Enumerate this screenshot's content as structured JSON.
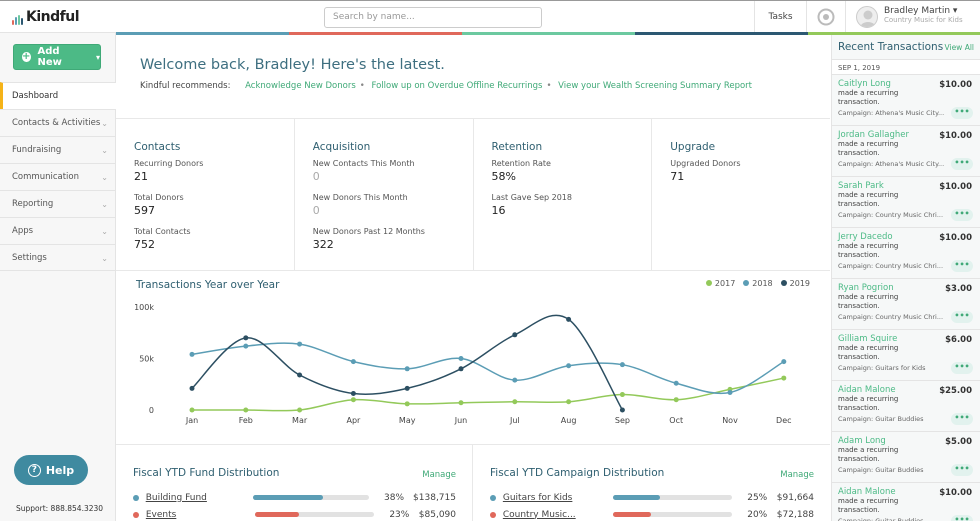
{
  "header": {
    "logo": "Kindful",
    "search_placeholder": "Search by name...",
    "tasks": "Tasks",
    "user_name": "Bradley Martin",
    "user_org": "Country Music for Kids"
  },
  "colors": {
    "accent": "#4cba86",
    "bar": [
      "#5b9db5",
      "#e0685b",
      "#6cc9a0",
      "#2c5872",
      "#93c95a"
    ]
  },
  "sidebar": {
    "add_new": "Add New",
    "items": [
      {
        "label": "Dashboard"
      },
      {
        "label": "Contacts & Activities"
      },
      {
        "label": "Fundraising"
      },
      {
        "label": "Communication"
      },
      {
        "label": "Reporting"
      },
      {
        "label": "Apps"
      },
      {
        "label": "Settings"
      }
    ],
    "help": "Help",
    "support": "Support: 888.854.3230"
  },
  "welcome": {
    "title": "Welcome back, Bradley! Here's the latest.",
    "recommends_label": "Kindful recommends:",
    "links": [
      "Acknowledge New Donors",
      "Follow up on Overdue Offline Recurrings",
      "View your Wealth Screening Summary Report"
    ]
  },
  "stats": [
    {
      "title": "Contacts",
      "items": [
        {
          "label": "Recurring Donors",
          "value": "21"
        },
        {
          "label": "Total Donors",
          "value": "597"
        },
        {
          "label": "Total Contacts",
          "value": "752"
        }
      ]
    },
    {
      "title": "Acquisition",
      "items": [
        {
          "label": "New Contacts This Month",
          "value": "0"
        },
        {
          "label": "New Donors This Month",
          "value": "0"
        },
        {
          "label": "New Donors Past 12 Months",
          "value": "322"
        }
      ]
    },
    {
      "title": "Retention",
      "items": [
        {
          "label": "Retention Rate",
          "value": "58%"
        },
        {
          "label": "Last Gave Sep 2018",
          "value": "16"
        }
      ]
    },
    {
      "title": "Upgrade",
      "items": [
        {
          "label": "Upgraded Donors",
          "value": "71"
        }
      ]
    }
  ],
  "chart_data": {
    "type": "line",
    "title": "Transactions Year over Year",
    "categories": [
      "Jan",
      "Feb",
      "Mar",
      "Apr",
      "May",
      "Jun",
      "Jul",
      "Aug",
      "Sep",
      "Oct",
      "Nov",
      "Dec"
    ],
    "ylim": [
      0,
      100000
    ],
    "yticks": [
      {
        "v": 0,
        "label": "0"
      },
      {
        "v": 50000,
        "label": "50k"
      },
      {
        "v": 100000,
        "label": "100k"
      }
    ],
    "legend": "top-right",
    "series": [
      {
        "name": "2017",
        "color": "#93c95a",
        "values": [
          0,
          0,
          0,
          10000,
          6000,
          7000,
          8000,
          8000,
          15000,
          10000,
          20000,
          31000
        ]
      },
      {
        "name": "2018",
        "color": "#5b9db5",
        "values": [
          54000,
          62000,
          64000,
          47000,
          40000,
          50000,
          29000,
          43000,
          44000,
          26000,
          17000,
          47000
        ]
      },
      {
        "name": "2019",
        "color": "#2c4f62",
        "values": [
          21000,
          70000,
          34000,
          16000,
          21000,
          40000,
          73000,
          88000,
          0
        ]
      }
    ]
  },
  "fund": {
    "title": "Fiscal YTD Fund Distribution",
    "manage": "Manage",
    "rows": [
      {
        "name": "Building Fund",
        "pct": "38%",
        "fill": 38,
        "amount": "$138,715",
        "color": "#5b9db5"
      },
      {
        "name": "Events",
        "pct": "23%",
        "fill": 23,
        "amount": "$85,090",
        "color": "#e0685b"
      }
    ]
  },
  "campaign": {
    "title": "Fiscal YTD Campaign Distribution",
    "manage": "Manage",
    "rows": [
      {
        "name": "Guitars for Kids",
        "pct": "25%",
        "fill": 25,
        "amount": "$91,664",
        "color": "#5b9db5"
      },
      {
        "name": "Country Music...",
        "pct": "20%",
        "fill": 20,
        "amount": "$72,188",
        "color": "#e0685b"
      }
    ]
  },
  "recent": {
    "title": "Recent Transactions",
    "view_all": "View All",
    "date": "SEP 1, 2019",
    "items": [
      {
        "name": "Caitlyn Long",
        "amount": "$10.00",
        "msg": "made a recurring transaction.",
        "campaign": "Campaign: Athena's Music City..."
      },
      {
        "name": "Jordan Gallagher",
        "amount": "$10.00",
        "msg": "made a recurring transaction.",
        "campaign": "Campaign: Athena's Music City..."
      },
      {
        "name": "Sarah Park",
        "amount": "$10.00",
        "msg": "made a recurring transaction.",
        "campaign": "Campaign: Country Music Chri..."
      },
      {
        "name": "Jerry Dacedo",
        "amount": "$10.00",
        "msg": "made a recurring transaction.",
        "campaign": "Campaign: Country Music Chri..."
      },
      {
        "name": "Ryan Pogrion",
        "amount": "$3.00",
        "msg": "made a recurring transaction.",
        "campaign": "Campaign: Country Music Chri..."
      },
      {
        "name": "Gilliam Squire",
        "amount": "$6.00",
        "msg": "made a recurring transaction.",
        "campaign": "Campaign: Guitars for Kids"
      },
      {
        "name": "Aidan Malone",
        "amount": "$25.00",
        "msg": "made a recurring transaction.",
        "campaign": "Campaign: Guitar Buddies"
      },
      {
        "name": "Adam Long",
        "amount": "$5.00",
        "msg": "made a recurring transaction.",
        "campaign": "Campaign: Guitar Buddies"
      },
      {
        "name": "Aidan Malone",
        "amount": "$10.00",
        "msg": "made a recurring transaction.",
        "campaign": "Campaign: Guitar Buddies"
      }
    ]
  }
}
